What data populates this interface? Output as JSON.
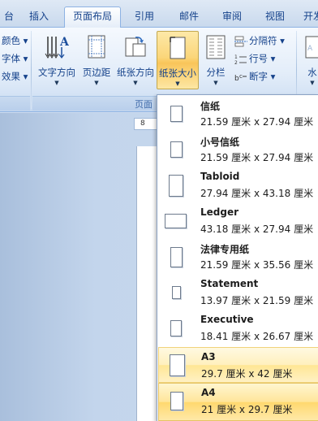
{
  "tabs": [
    {
      "label": "台"
    },
    {
      "label": "插入"
    },
    {
      "label": "页面布局"
    },
    {
      "label": "引用"
    },
    {
      "label": "邮件"
    },
    {
      "label": "审阅"
    },
    {
      "label": "视图"
    },
    {
      "label": "开发"
    }
  ],
  "ribbon": {
    "theme_items": [
      "颜色 ▾",
      "字体 ▾",
      "效果 ▾"
    ],
    "buttons": {
      "text_direction": "文字方向",
      "margins": "页边距",
      "orientation": "纸张方向",
      "size": "纸张大小",
      "columns": "分栏",
      "water": "水"
    },
    "small_buttons": {
      "breaks": "分隔符 ▾",
      "line_numbers": "行号 ▾",
      "hyphenation": "断字 ▾"
    },
    "group_label": "页面"
  },
  "ruler": {
    "mark": "8"
  },
  "paper_sizes": [
    {
      "name": "信纸",
      "size": "21.59 厘米 x 27.94 厘米"
    },
    {
      "name": "小号信纸",
      "size": "21.59 厘米 x 27.94 厘米"
    },
    {
      "name": "Tabloid",
      "size": "27.94 厘米 x 43.18 厘米"
    },
    {
      "name": "Ledger",
      "size": "43.18 厘米 x 27.94 厘米"
    },
    {
      "name": "法律专用纸",
      "size": "21.59 厘米 x 35.56 厘米"
    },
    {
      "name": "Statement",
      "size": "13.97 厘米 x 21.59 厘米"
    },
    {
      "name": "Executive",
      "size": "18.41 厘米 x 26.67 厘米"
    },
    {
      "name": "A3",
      "size": "29.7 厘米 x 42 厘米"
    },
    {
      "name": "A4",
      "size": "21 厘米 x 29.7 厘米"
    }
  ]
}
